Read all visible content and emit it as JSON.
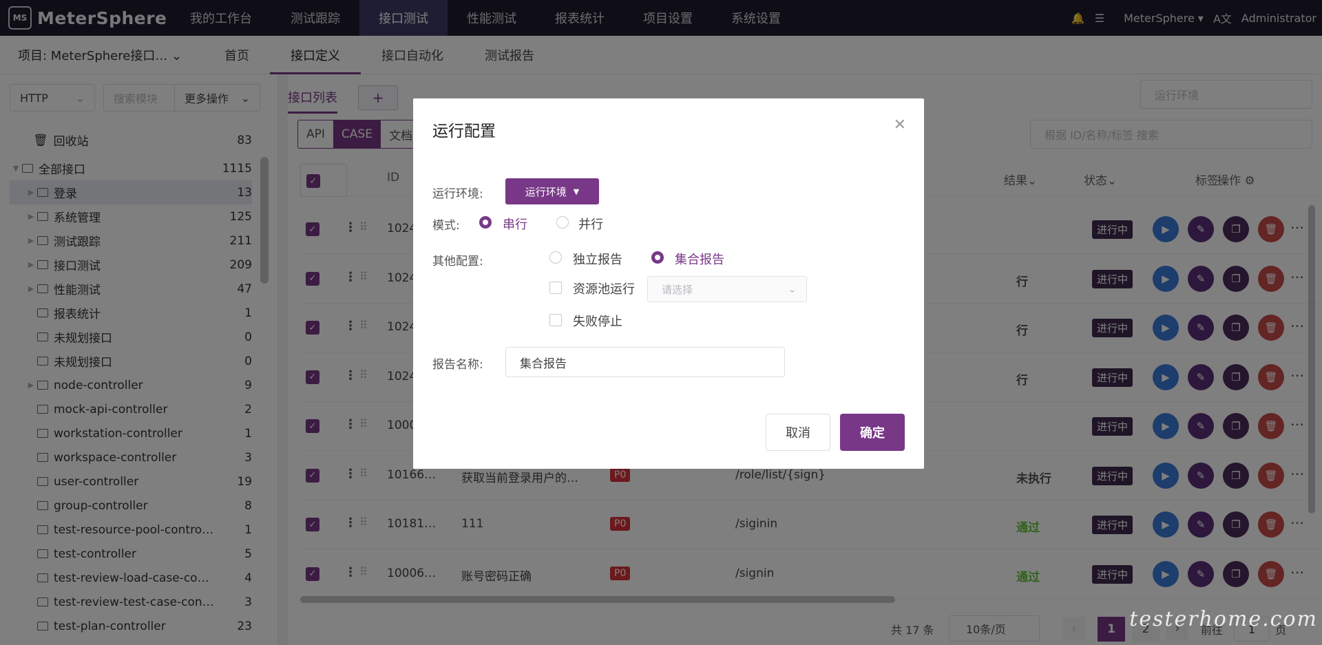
{
  "app": {
    "logo_mark": "MS",
    "logo_text": "MeterSphere"
  },
  "topnav": [
    {
      "label": "我的工作台",
      "active": false
    },
    {
      "label": "测试跟踪",
      "active": false
    },
    {
      "label": "接口测试",
      "active": true
    },
    {
      "label": "性能测试",
      "active": false
    },
    {
      "label": "报表统计",
      "active": false
    },
    {
      "label": "项目设置",
      "active": false
    },
    {
      "label": "系统设置",
      "active": false
    }
  ],
  "topright": {
    "bell": "bell-icon",
    "task": "task-list-icon",
    "workspace": "MeterSphere",
    "lang": "A文",
    "user": "Administrator"
  },
  "subbar": {
    "project": "项目: MeterSphere接口… ⌄",
    "tabs": [
      {
        "label": "首页",
        "active": false
      },
      {
        "label": "接口定义",
        "active": true
      },
      {
        "label": "接口自动化",
        "active": false
      },
      {
        "label": "测试报告",
        "active": false
      }
    ]
  },
  "sidebar": {
    "protocol": "HTTP",
    "search_placeholder": "搜索模块",
    "more_ops": "更多操作",
    "recycle": {
      "label": "回收站",
      "count": "83"
    },
    "root": {
      "label": "全部接口",
      "count": "1115"
    },
    "items": [
      {
        "label": "登录",
        "count": "13",
        "caret": true,
        "hl": true
      },
      {
        "label": "系统管理",
        "count": "125",
        "caret": true
      },
      {
        "label": "测试跟踪",
        "count": "211",
        "caret": true
      },
      {
        "label": "接口测试",
        "count": "209",
        "caret": true
      },
      {
        "label": "性能测试",
        "count": "47",
        "caret": true
      },
      {
        "label": "报表统计",
        "count": "1",
        "caret": false
      },
      {
        "label": "未规划接口",
        "count": "0",
        "caret": false
      },
      {
        "label": "未规划接口",
        "count": "0",
        "caret": false
      },
      {
        "label": "node-controller",
        "count": "9",
        "caret": true
      },
      {
        "label": "mock-api-controller",
        "count": "2",
        "caret": false
      },
      {
        "label": "workstation-controller",
        "count": "1",
        "caret": false
      },
      {
        "label": "workspace-controller",
        "count": "3",
        "caret": false
      },
      {
        "label": "user-controller",
        "count": "19",
        "caret": false
      },
      {
        "label": "group-controller",
        "count": "8",
        "caret": false
      },
      {
        "label": "test-resource-pool-contro…",
        "count": "1",
        "caret": false
      },
      {
        "label": "test-controller",
        "count": "5",
        "caret": false
      },
      {
        "label": "test-review-load-case-co…",
        "count": "4",
        "caret": false
      },
      {
        "label": "test-review-test-case-con…",
        "count": "3",
        "caret": false
      },
      {
        "label": "test-plan-controller",
        "count": "23",
        "caret": false
      }
    ]
  },
  "main": {
    "list_tab": "接口列表",
    "add_tab": "+",
    "env_placeholder": "运行环境",
    "mode_api": "API",
    "mode_case": "CASE",
    "mode_doc": "文档",
    "search_placeholder": "根据 ID/名称/标签 搜索",
    "headers": {
      "id": "ID",
      "result": "结果",
      "status": "状态",
      "tag": "标签",
      "ops": "操作"
    },
    "rows": [
      {
        "id": "1024…",
        "name": "",
        "path": "",
        "result": "",
        "status": "进行中"
      },
      {
        "id": "1024…",
        "name": "",
        "path": "",
        "result": "行",
        "status": "进行中"
      },
      {
        "id": "1024…",
        "name": "",
        "path": "",
        "result": "行",
        "status": "进行中"
      },
      {
        "id": "1024…",
        "name": "",
        "path": "",
        "result": "行",
        "status": "进行中"
      },
      {
        "id": "1000…",
        "name": "",
        "path": "",
        "result": "",
        "status": "进行中"
      },
      {
        "id": "10166…",
        "name": "获取当前登录用户的…",
        "priority": "P0",
        "path": "/role/list/{sign}",
        "result": "未执行",
        "status": "进行中"
      },
      {
        "id": "10181…",
        "name": "111",
        "priority": "P0",
        "path": "/siginin",
        "result": "通过",
        "status": "进行中"
      },
      {
        "id": "10006…",
        "name": "账号密码正确",
        "priority": "P0",
        "path": "/signin",
        "result": "通过",
        "status": "进行中"
      }
    ],
    "pagination": {
      "total": "共 17 条",
      "page_size": "10条/页",
      "current": "1",
      "next": "2",
      "goto_label": "前往",
      "goto_value": "1",
      "goto_suffix": "页"
    }
  },
  "dialog": {
    "title": "运行配置",
    "env_label": "运行环境:",
    "env_button": "运行环境",
    "mode_label": "模式:",
    "mode_serial": "串行",
    "mode_parallel": "并行",
    "other_label": "其他配置:",
    "report_independent": "独立报告",
    "report_combined": "集合报告",
    "pool_run": "资源池运行",
    "pool_placeholder": "请选择",
    "fail_stop": "失败停止",
    "report_name_label": "报告名称:",
    "report_name_value": "集合报告",
    "cancel": "取消",
    "confirm": "确定"
  },
  "watermark": "testerhome.com",
  "colors": {
    "accent": "#783887",
    "topbar": "#1e1d2e",
    "success": "#67c23a",
    "danger": "#d8323a"
  }
}
